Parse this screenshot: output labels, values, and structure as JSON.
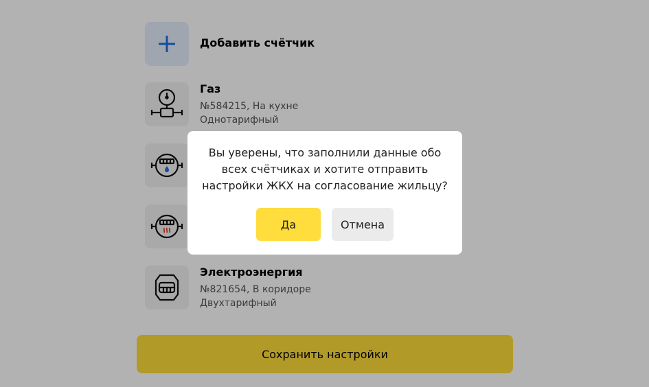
{
  "add_meter": {
    "label": "Добавить счётчик",
    "icon": "plus-icon"
  },
  "meters": [
    {
      "icon": "gas-meter-icon",
      "title": "Газ",
      "number": "№584215, На кухне",
      "tariff": "Однотарифный"
    },
    {
      "icon": "cold-water-meter-icon",
      "title": "",
      "number": "",
      "tariff": ""
    },
    {
      "icon": "hot-water-meter-icon",
      "title": "",
      "number": "",
      "tariff": ""
    },
    {
      "icon": "electricity-meter-icon",
      "title": "Электроэнергия",
      "number": "№821654, В коридоре",
      "tariff": "Двухтарифный"
    }
  ],
  "save_button": {
    "label": "Сохранить настройки"
  },
  "dialog": {
    "message": "Вы уверены, что заполнили данные обо всех счётчиках и хотите отправить настройки ЖКХ на согласование жильцу?",
    "confirm_label": "Да",
    "cancel_label": "Отмена"
  },
  "colors": {
    "accent": "#ffdd3c",
    "plus_blue": "#1f6fe0",
    "water_blue": "#1f6fe0",
    "hot_red": "#e0412a",
    "overlay": "rgba(0,0,0,0.3)"
  }
}
